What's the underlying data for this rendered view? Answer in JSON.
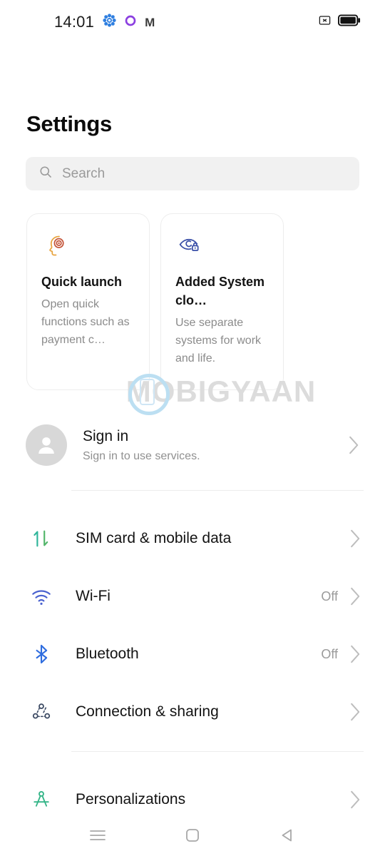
{
  "status_bar": {
    "time": "14:01",
    "icons_left": [
      "settings-gear-icon",
      "circle-ring-icon",
      "gmail-icon"
    ],
    "icons_right": [
      "no-signal-icon",
      "battery-full-icon"
    ],
    "gmail_letter": "M"
  },
  "header": {
    "title": "Settings"
  },
  "search": {
    "placeholder": "Search",
    "icon": "search-icon"
  },
  "cards": [
    {
      "icon": "head-target-icon",
      "title": "Quick launch",
      "description": "Open quick functions such as payment c…",
      "accent": "#e8a33d"
    },
    {
      "icon": "eye-lock-icon",
      "title": "Added System clo…",
      "description": "Use separate systems for work and life.",
      "accent": "#3b50a8"
    }
  ],
  "watermark": {
    "text": "MOBIGYAAN",
    "color": "#dcdcdc"
  },
  "account": {
    "title": "Sign in",
    "subtitle": "Sign in to use services.",
    "avatar": "person-avatar-icon",
    "chevron": "chevron-right-icon"
  },
  "settings_groups": [
    {
      "items": [
        {
          "icon": "sim-data-arrows-icon",
          "label": "SIM card & mobile data",
          "value": "",
          "color": "#2fb59a"
        },
        {
          "icon": "wifi-icon",
          "label": "Wi-Fi",
          "value": "Off",
          "color": "#4a62cf"
        },
        {
          "icon": "bluetooth-icon",
          "label": "Bluetooth",
          "value": "Off",
          "color": "#2f6ddf"
        },
        {
          "icon": "connection-sharing-icon",
          "label": "Connection & sharing",
          "value": "",
          "color": "#3c4a63"
        }
      ]
    },
    {
      "items": [
        {
          "icon": "compass-personalizations-icon",
          "label": "Personalizations",
          "value": "",
          "color": "#35b588"
        }
      ]
    }
  ],
  "nav_bar": {
    "recents_label": "recents-menu-icon",
    "home_label": "home-square-icon",
    "back_label": "back-triangle-icon"
  }
}
